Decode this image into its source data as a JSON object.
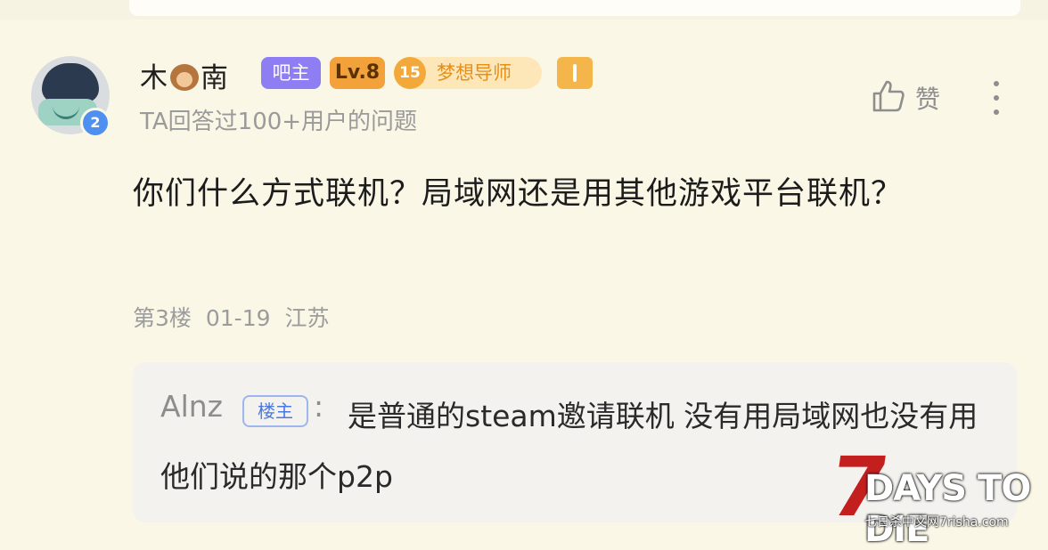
{
  "post": {
    "username_a": "木",
    "username_b": "南",
    "avatar_badge": "2",
    "role_badge": "吧主",
    "level_badge": "Lv.8",
    "mentor_level": "15",
    "mentor_label": "梦想导师",
    "subtitle": "TA回答过100+用户的问题",
    "like_label": "赞",
    "content": "你们什么方式联机？局域网还是用其他游戏平台联机？",
    "floor": "第3楼",
    "date": "01-19",
    "location": "江苏"
  },
  "reply": {
    "author": "Alnz",
    "author_tag": "楼主",
    "colon": ":",
    "text": "是普通的steam邀请联机 没有用局域网也没有用他们说的那个p2p"
  },
  "watermark": {
    "seven": "7",
    "title": "DAYS TO DIE",
    "subtitle": "七日杀中文网7risha.com"
  },
  "colors": {
    "background": "#fbf7e6",
    "role_badge": "#8e7ef3",
    "level_badge": "#f3a13b",
    "mentor_badge": "#fde7b8",
    "reply_tag": "#4b78e0"
  },
  "icons": {
    "like": "thumbs-up-icon",
    "more": "vertical-ellipsis-icon",
    "extra_badge": "info-badge-icon"
  }
}
